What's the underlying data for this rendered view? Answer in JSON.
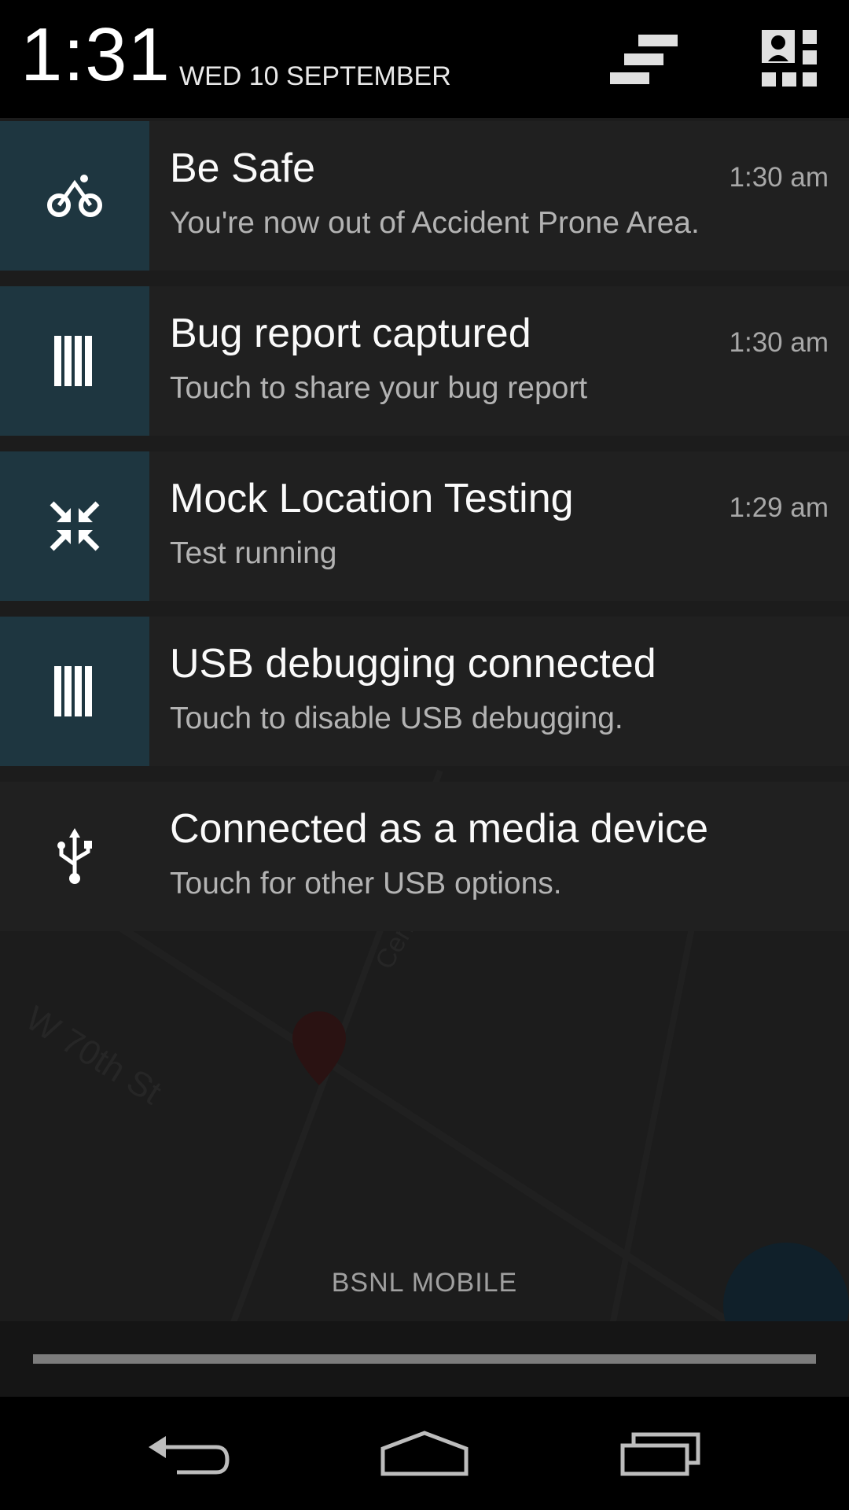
{
  "header": {
    "time": "1:31",
    "date": "WED 10 SEPTEMBER"
  },
  "notifications": [
    {
      "title": "Be Safe",
      "text": "You're now out of Accident Prone Area.",
      "time": "1:30 am",
      "icon": "bicycle-icon"
    },
    {
      "title": "Bug report captured",
      "text": "Touch to share your bug report",
      "time": "1:30 am",
      "icon": "bug-report-icon"
    },
    {
      "title": "Mock Location Testing",
      "text": "Test running",
      "time": "1:29 am",
      "icon": "compress-arrows-icon"
    },
    {
      "title": "USB debugging connected",
      "text": "Touch to disable USB debugging.",
      "time": "",
      "icon": "usb-debugging-icon"
    },
    {
      "title": "Connected as a media device",
      "text": "Touch for other USB options.",
      "time": "",
      "icon": "usb-icon"
    }
  ],
  "background_map": {
    "street_label": "W 70th St",
    "street_label2": "Cen"
  },
  "carrier": "BSNL MOBILE",
  "colors": {
    "icon_box": "#1e3640",
    "card": "#202020",
    "header": "#000000"
  }
}
